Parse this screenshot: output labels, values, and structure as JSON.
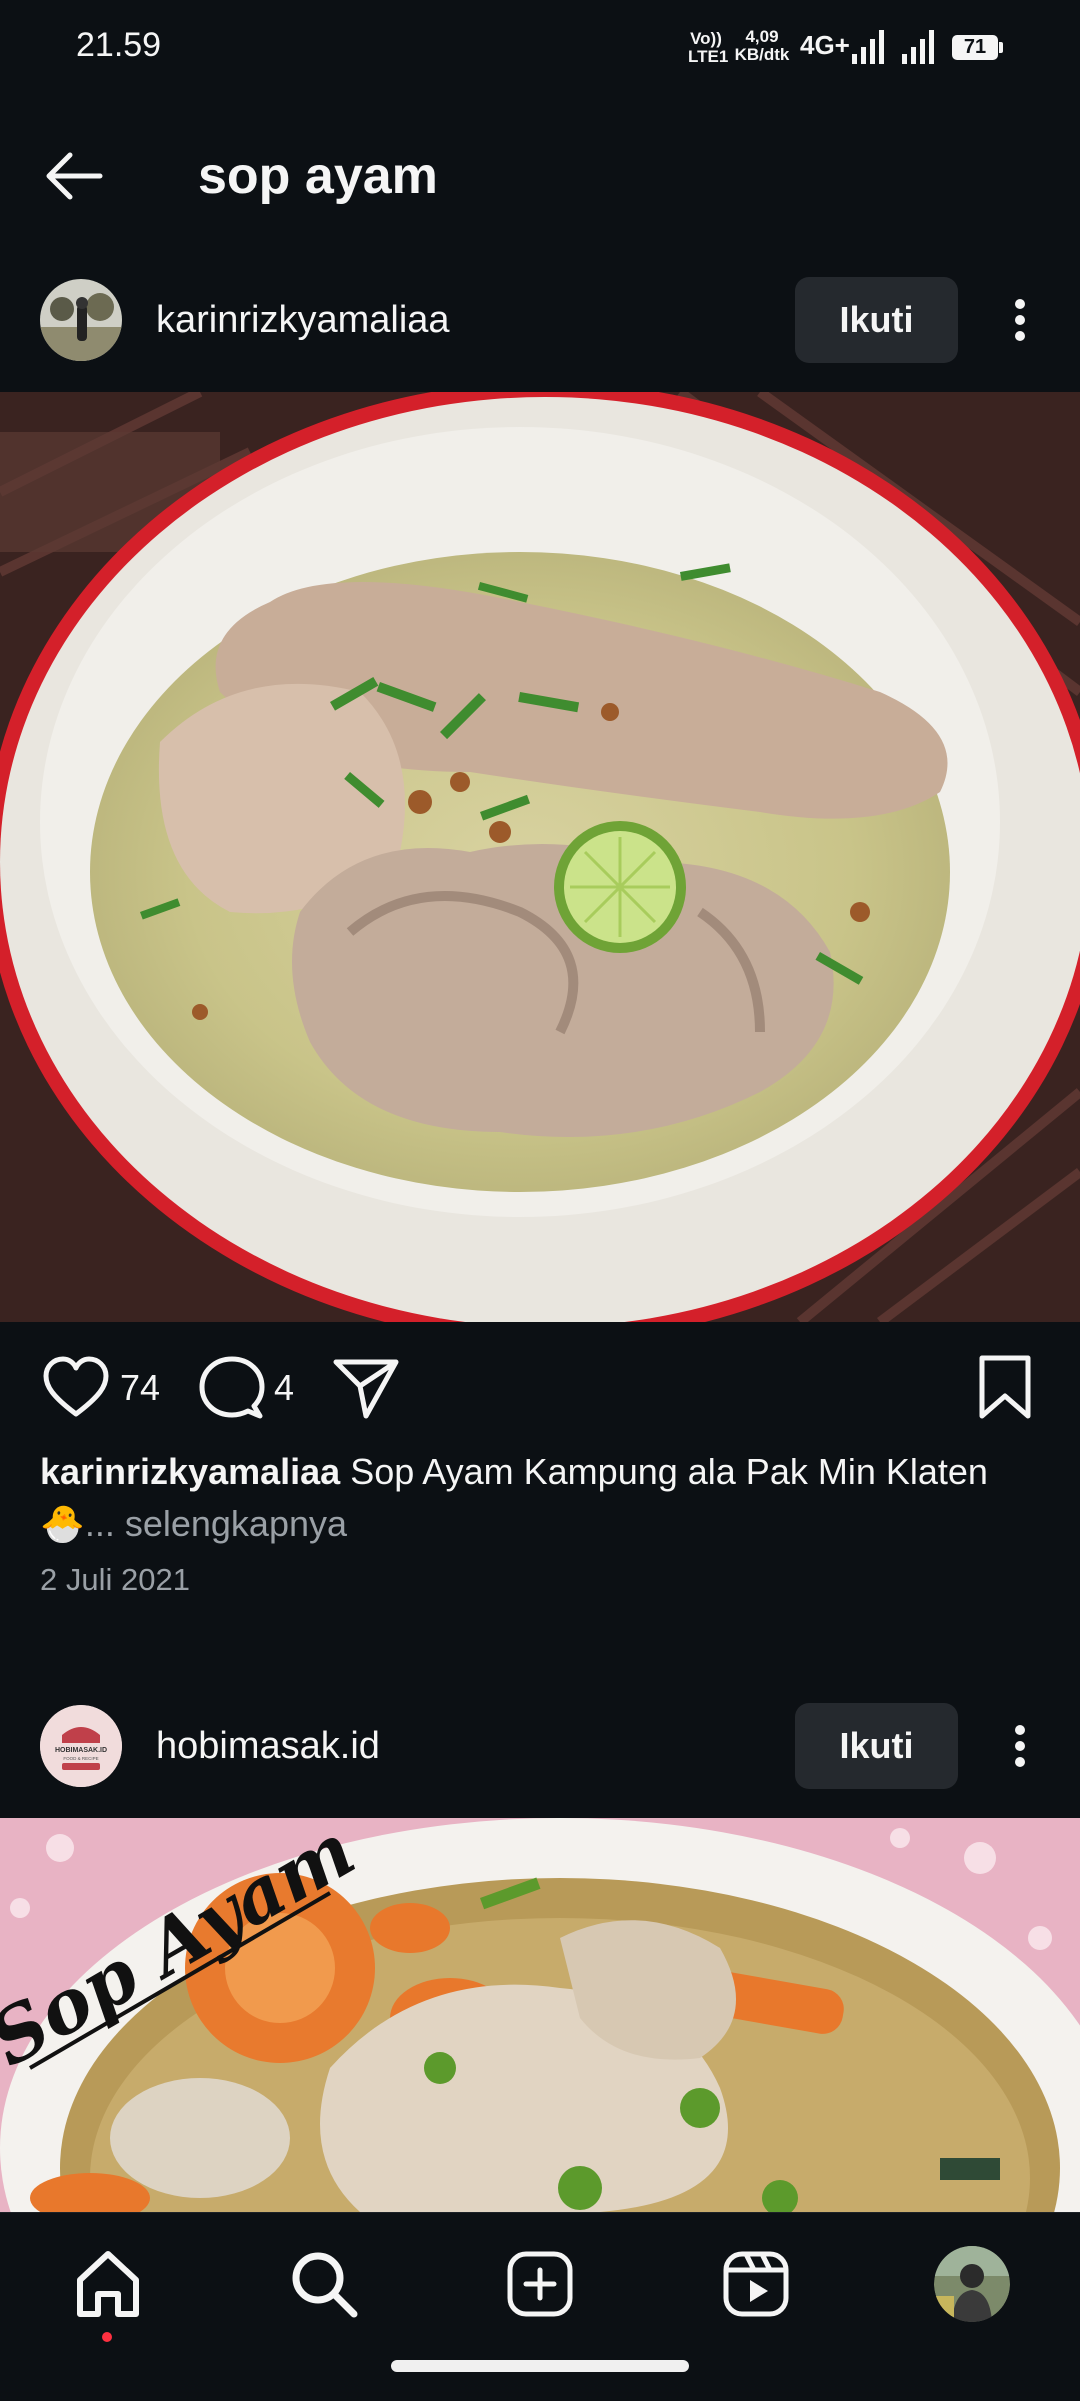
{
  "status_bar": {
    "time": "21.59",
    "volte_top": "Vo))",
    "volte_bottom": "LTE1",
    "speed_top": "4,09",
    "speed_bottom": "KB/dtk",
    "network": "4G+",
    "battery": "71"
  },
  "header": {
    "title": "sop ayam",
    "back_icon": "arrow-left-icon"
  },
  "posts": [
    {
      "username": "karinrizkyamaliaa",
      "follow_label": "Ikuti",
      "likes": "74",
      "comments": "4",
      "caption_user": "karinrizkyamaliaa",
      "caption_text": " Sop Ayam Kampung ala Pak Min Klaten",
      "caption_emoji": "🐣",
      "caption_more": "... selengkapnya",
      "date": "2 Juli 2021"
    },
    {
      "username": "hobimasak.id",
      "follow_label": "Ikuti",
      "image_overlay_text": "Sop Ayam",
      "avatar_text_top": "HOBIMASAK.ID",
      "avatar_text_bottom": "FOOD & RECIPE"
    }
  ],
  "bottom_nav": {
    "items": [
      "home-icon",
      "search-icon",
      "create-icon",
      "reels-icon",
      "profile-avatar"
    ]
  },
  "colors": {
    "background": "#0c1014",
    "button": "#25292e",
    "secondary_text": "#9aa0a6",
    "notification_dot": "#ff3040"
  }
}
